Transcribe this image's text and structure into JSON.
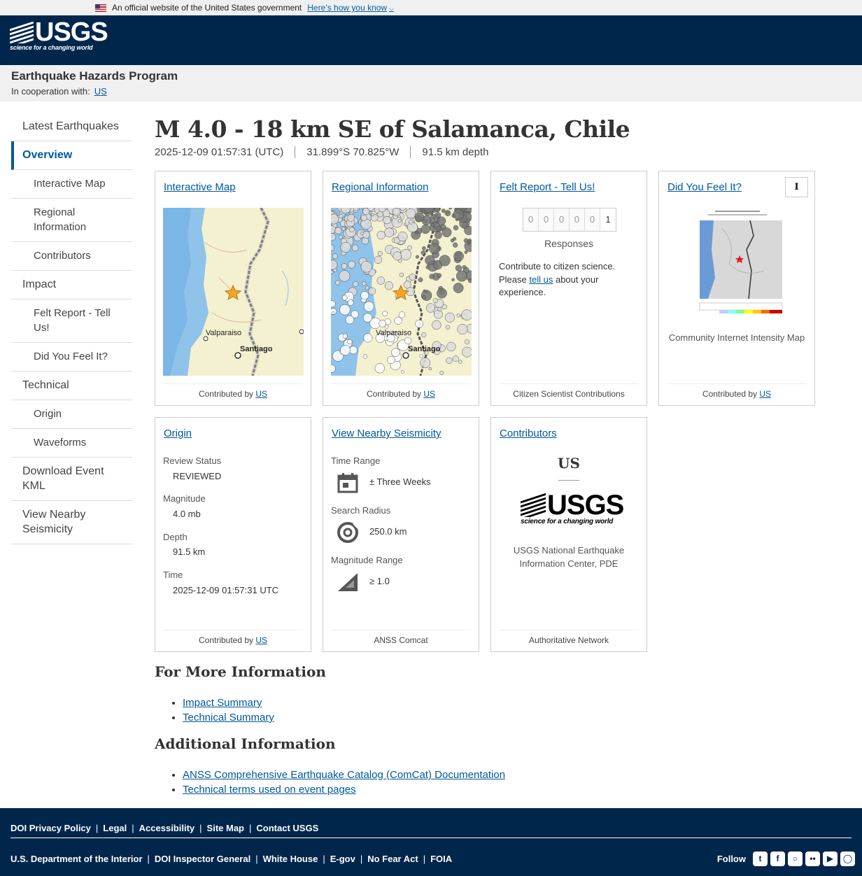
{
  "gov_banner": {
    "text": "An official website of the United States government",
    "link": "Here’s how you know"
  },
  "header": {
    "logo_text": "USGS",
    "logo_tagline": "science for a changing world"
  },
  "program": {
    "title": "Earthquake Hazards Program",
    "coop_label": "In cooperation with:",
    "coop_link": "US"
  },
  "sidebar": {
    "items": [
      {
        "label": "Latest Earthquakes"
      },
      {
        "label": "Overview"
      },
      {
        "label": "Interactive Map"
      },
      {
        "label": "Regional Information"
      },
      {
        "label": "Contributors"
      },
      {
        "label": "Impact"
      },
      {
        "label": "Felt Report - Tell Us!"
      },
      {
        "label": "Did You Feel It?"
      },
      {
        "label": "Technical"
      },
      {
        "label": "Origin"
      },
      {
        "label": "Waveforms"
      },
      {
        "label": "Download Event KML"
      },
      {
        "label": "View Nearby Seismicity"
      }
    ]
  },
  "event": {
    "title": "M 4.0 - 18 km SE of Salamanca, Chile",
    "time": "2025-12-09 01:57:31 (UTC)",
    "location": "31.899°S 70.825°W",
    "depth": "91.5 km depth"
  },
  "cards": {
    "interactive_map": {
      "title": "Interactive Map",
      "footer_prefix": "Contributed by",
      "footer_link": "US",
      "map_labels": {
        "city1": "Valparaiso",
        "city2": "Santiago"
      }
    },
    "regional": {
      "title": "Regional Information",
      "footer_prefix": "Contributed by",
      "footer_link": "US",
      "map_labels": {
        "city1": "Valparaiso",
        "city2": "Santiago"
      }
    },
    "felt_report": {
      "title": "Felt Report - Tell Us!",
      "digits": [
        "0",
        "0",
        "0",
        "0",
        "0",
        "1"
      ],
      "responses": "Responses",
      "text_before": "Contribute to citizen science. Please",
      "text_link": "tell us",
      "text_after": "about your experience.",
      "footer": "Citizen Scientist Contributions"
    },
    "dyfi": {
      "title": "Did You Feel It?",
      "info_button": "I",
      "caption": "Community Internet Intensity Map",
      "footer_prefix": "Contributed by",
      "footer_link": "US"
    },
    "origin": {
      "title": "Origin",
      "review_label": "Review Status",
      "review_value": "REVIEWED",
      "magnitude_label": "Magnitude",
      "magnitude_value": "4.0 mb",
      "depth_label": "Depth",
      "depth_value": "91.5 km",
      "time_label": "Time",
      "time_value": "2025-12-09 01:57:31 UTC",
      "footer_prefix": "Contributed by",
      "footer_link": "US"
    },
    "seismicity": {
      "title": "View Nearby Seismicity",
      "time_range_label": "Time Range",
      "time_range_value": "± Three Weeks",
      "radius_label": "Search Radius",
      "radius_value": "250.0 km",
      "mag_label": "Magnitude Range",
      "mag_value": "≥ 1.0",
      "footer": "ANSS Comcat"
    },
    "contributors": {
      "title": "Contributors",
      "code": "US",
      "name": "USGS National Earthquake Information Center, PDE",
      "footer": "Authoritative Network"
    }
  },
  "more_info": {
    "heading": "For More Information",
    "links": [
      "Impact Summary",
      "Technical Summary"
    ]
  },
  "additional": {
    "heading": "Additional Information",
    "links": [
      "ANSS Comprehensive Earthquake Catalog (ComCat) Documentation",
      "Technical terms used on event pages"
    ]
  },
  "footer": {
    "row1": [
      "DOI Privacy Policy",
      "Legal",
      "Accessibility",
      "Site Map",
      "Contact USGS"
    ],
    "row2": [
      "U.S. Department of the Interior",
      "DOI Inspector General",
      "White House",
      "E-gov",
      "No Fear Act",
      "FOIA"
    ],
    "follow": "Follow",
    "social_icons": [
      "twitter-icon",
      "facebook-icon",
      "github-icon",
      "flickr-icon",
      "youtube-icon",
      "instagram-icon"
    ]
  }
}
